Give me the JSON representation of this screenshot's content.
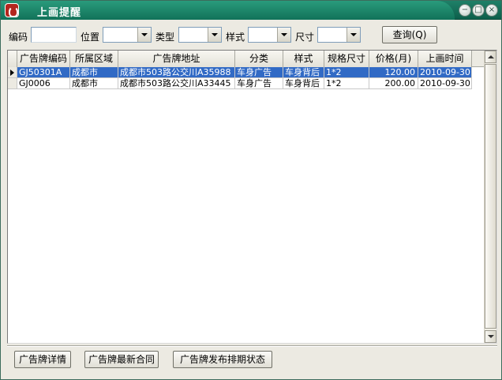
{
  "window": {
    "title": "上画提醒",
    "minimize_glyph": "−",
    "maximize_glyph": "□",
    "close_glyph": "×"
  },
  "search": {
    "code_label": "编码",
    "position_label": "位置",
    "type_label": "类型",
    "style_label": "样式",
    "size_label": "尺寸",
    "query_button": "查询(Q)"
  },
  "table": {
    "columns": [
      "广告牌编码",
      "所属区域",
      "广告牌地址",
      "分类",
      "样式",
      "规格尺寸",
      "价格(月)",
      "上画时间"
    ],
    "rows": [
      [
        "GJ50301A",
        "成都市",
        "成都市503路公交川A35988",
        "车身广告",
        "车身背后",
        "1*2",
        "120.00",
        "2010-09-30"
      ],
      [
        "GJ0006",
        "成都市",
        "成都市503路公交川A33445",
        "车身广告",
        "车身背后",
        "1*2",
        "200.00",
        "2010-09-30"
      ]
    ]
  },
  "bottom": {
    "detail_button": "广告牌详情",
    "contract_button": "广告牌最新合同",
    "schedule_button": "广告牌发布排期状态"
  },
  "colors": {
    "titlebar": "#117259",
    "selection": "#316ac5"
  }
}
